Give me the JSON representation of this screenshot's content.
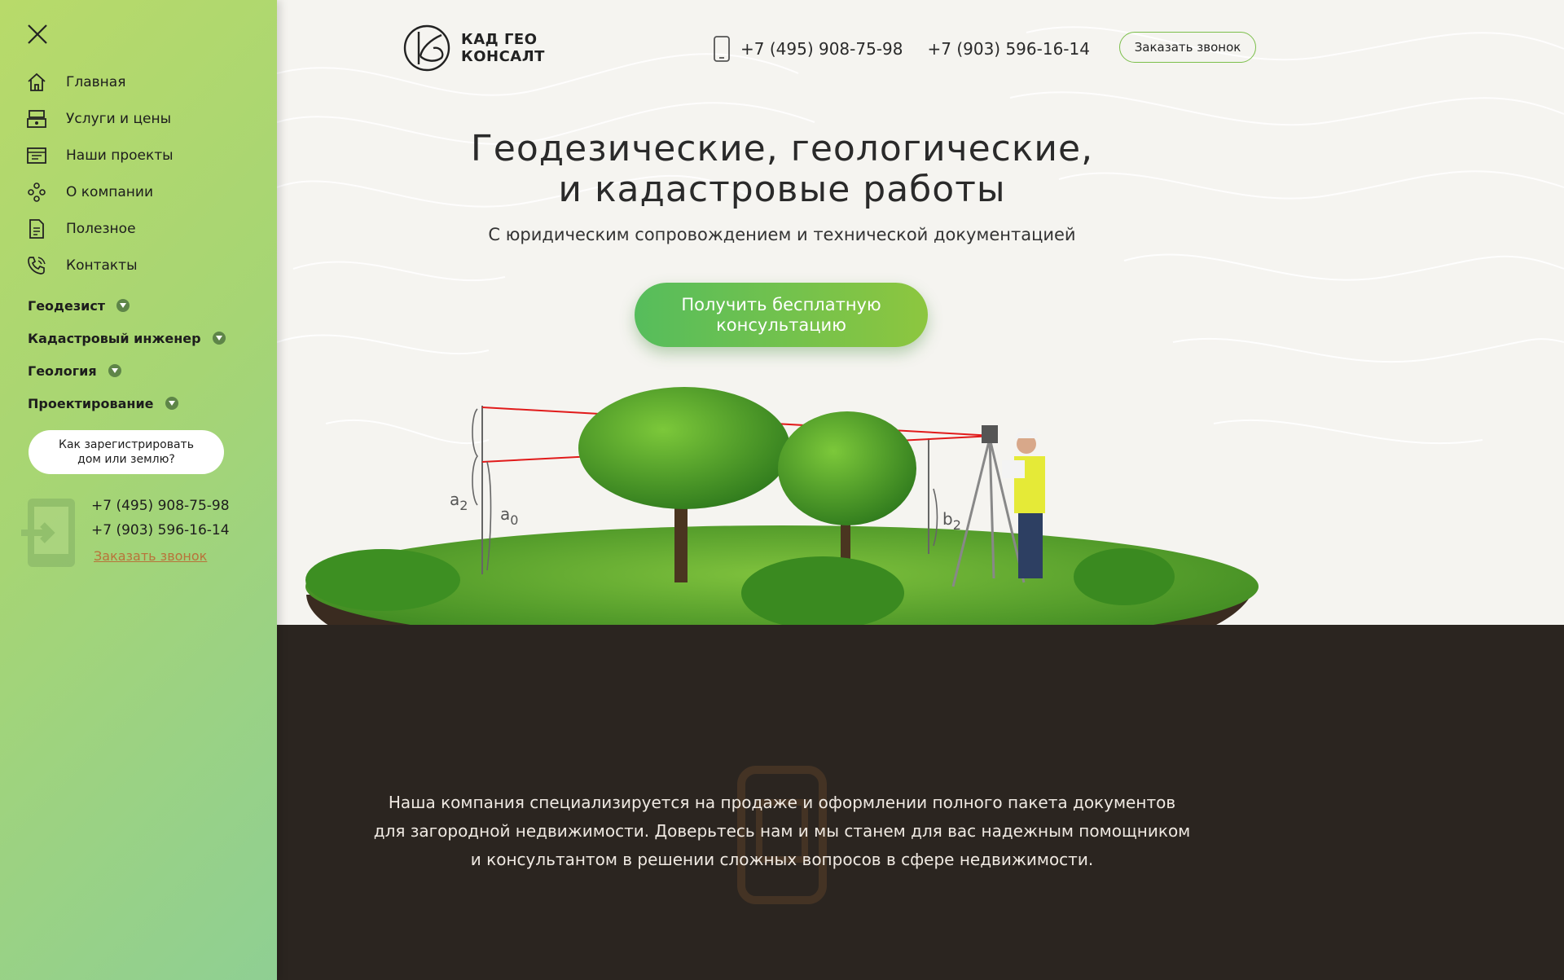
{
  "sidebar": {
    "nav": [
      {
        "label": "Главная",
        "icon": "home-icon"
      },
      {
        "label": "Услуги и цены",
        "icon": "cash-register-icon"
      },
      {
        "label": "Наши проекты",
        "icon": "projects-icon"
      },
      {
        "label": "О компании",
        "icon": "team-icon"
      },
      {
        "label": "Полезное",
        "icon": "document-icon"
      },
      {
        "label": "Контакты",
        "icon": "phone-icon"
      }
    ],
    "categories": [
      {
        "label": "Геодезист"
      },
      {
        "label": "Кадастровый инженер"
      },
      {
        "label": "Геология"
      },
      {
        "label": "Проектирование"
      }
    ],
    "register_button": "Как зарегистрировать дом или землю?",
    "phone_1": "+7 (495) 908-75-98",
    "phone_2": "+7 (903) 596-16-14",
    "call_link": "Заказать звонок"
  },
  "header": {
    "logo_line_1": "КАД ГЕО",
    "logo_line_2": "КОНСАЛТ",
    "phone_1": "+7 (495) 908-75-98",
    "phone_2": "+7 (903) 596-16-14",
    "call_button": "Заказать звонок"
  },
  "hero": {
    "title_line_1": "Геодезические, геологические,",
    "title_line_2": "и кадастровые работы",
    "subtitle": "С юридическим сопровождением и технической документацией",
    "cta": "Получить бесплатную консультацию",
    "labels": {
      "a2": "a",
      "a2_sub": "2",
      "a0": "a",
      "a0_sub": "0",
      "b2": "b",
      "b2_sub": "2"
    }
  },
  "about": {
    "line_1": "Наша компания специализируется на продаже и оформлении полного пакета документов",
    "line_2": "для загородной недвижимости. Доверьтесь нам и мы станем для вас надежным помощником",
    "line_3": "и консультантом в решении сложных вопросов в сфере недвижимости."
  },
  "colors": {
    "sidebar_start": "#b8da6a",
    "sidebar_end": "#8fcf93",
    "accent_green": "#56bd5c",
    "link_orange": "#b8733a",
    "dark_bg": "#2b2520"
  }
}
